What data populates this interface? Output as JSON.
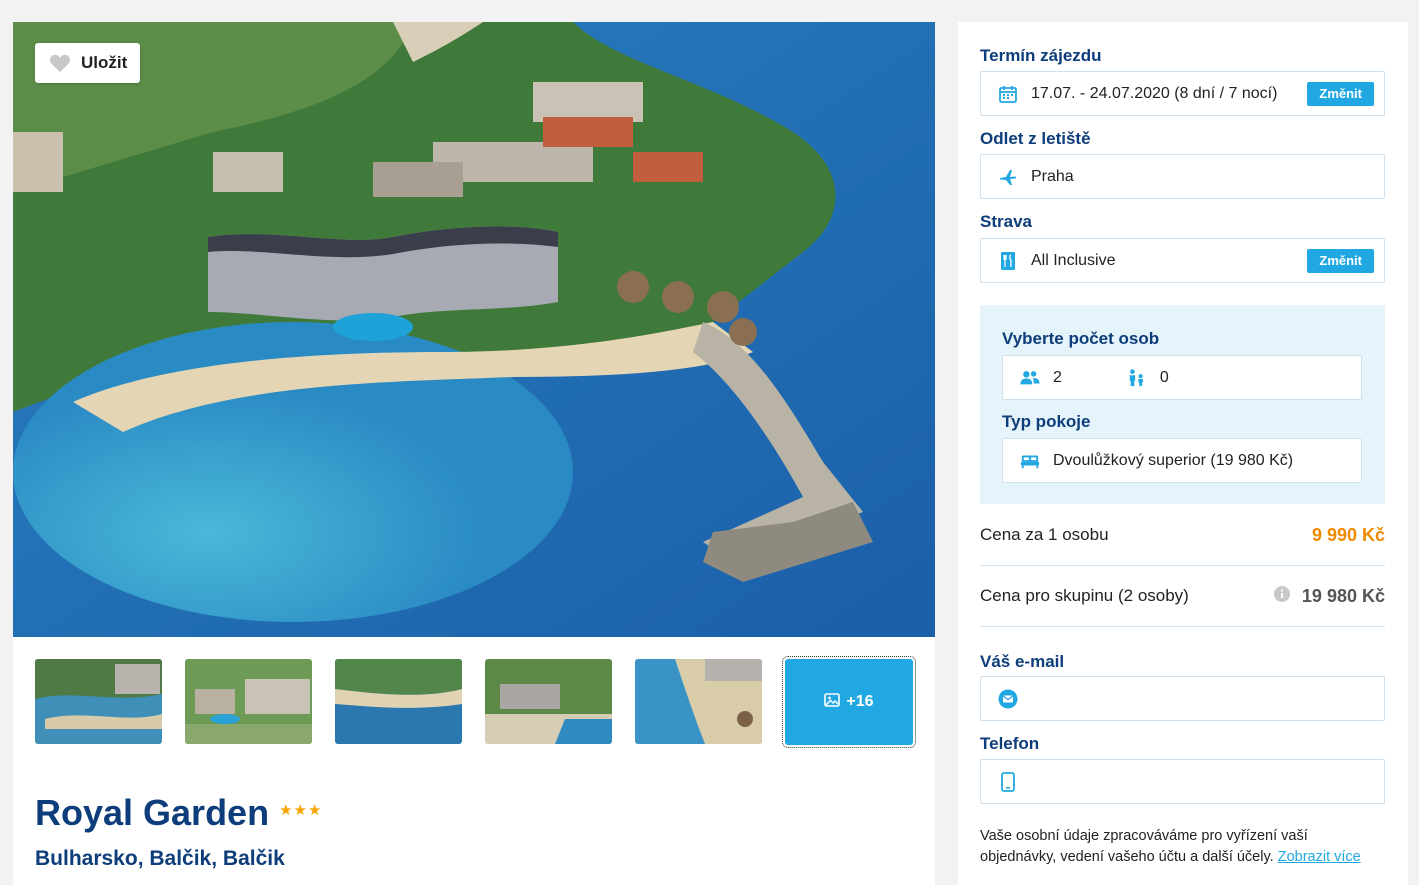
{
  "hero": {
    "save_label": "Uložit"
  },
  "gallery": {
    "more_label": "+16"
  },
  "hotel": {
    "name": "Royal Garden",
    "stars": "★★★",
    "location": "Bulharsko, Balčik, Balčik"
  },
  "booking": {
    "term_label": "Termín zájezdu",
    "term_value": "17.07. - 24.07.2020 (8 dní / 7 nocí)",
    "change_label": "Změnit",
    "airport_label": "Odlet z letiště",
    "airport_value": "Praha",
    "board_label": "Strava",
    "board_value": "All Inclusive",
    "persons_label": "Vyberte počet osob",
    "adults": "2",
    "children": "0",
    "room_label": "Typ pokoje",
    "room_value": "Dvoulůžkový superior (19 980 Kč)",
    "price_person_label": "Cena za 1 osobu",
    "price_person_value": "9 990 Kč",
    "price_group_label": "Cena pro skupinu (2 osoby)",
    "price_group_value": "19 980 Kč",
    "email_label": "Váš e-mail",
    "email_value": "",
    "phone_label": "Telefon",
    "phone_value": "",
    "privacy_text": "Vaše osobní údaje zpracováváme pro vyřízení vaší objednávky, vedení vašeho účtu a další účely.",
    "privacy_link": "Zobrazit více"
  },
  "colors": {
    "brand_blue": "#0d3d7a",
    "accent": "#21a7e2",
    "price_orange": "#f08a00",
    "stars": "#f6a400"
  }
}
